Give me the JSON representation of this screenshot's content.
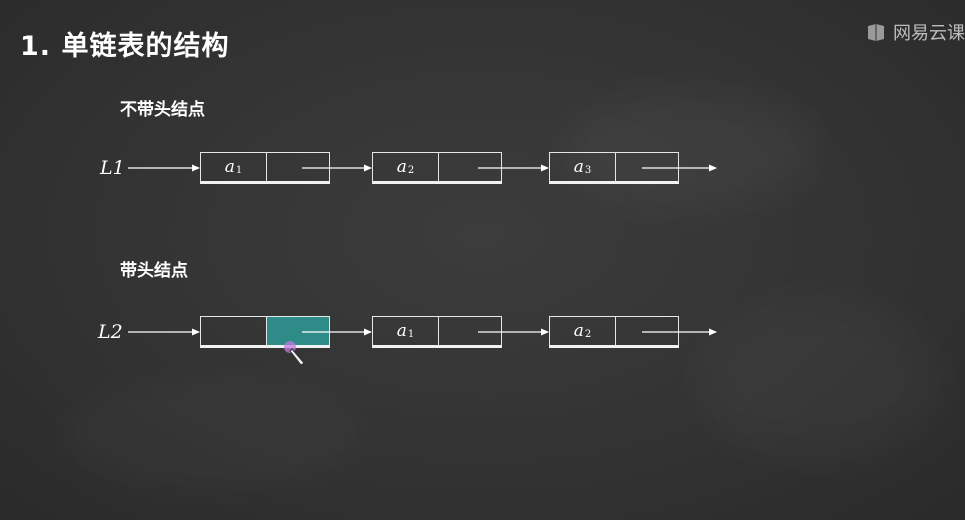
{
  "slide": {
    "title": "1. 单链表的结构",
    "brand": "网易云课"
  },
  "colors": {
    "background": "#333333",
    "chalk": "#ffffff",
    "highlight": "#2e8b88"
  },
  "sections": [
    {
      "label": "不带头结点",
      "list_label": "L1",
      "nodes": [
        {
          "var": "a",
          "sub": "1"
        },
        {
          "var": "a",
          "sub": "2"
        },
        {
          "var": "a",
          "sub": "3"
        }
      ]
    },
    {
      "label": "带头结点",
      "list_label": "L2",
      "nodes": [
        {
          "var": "",
          "sub": "",
          "head": true
        },
        {
          "var": "a",
          "sub": "1"
        },
        {
          "var": "a",
          "sub": "2"
        }
      ]
    }
  ]
}
